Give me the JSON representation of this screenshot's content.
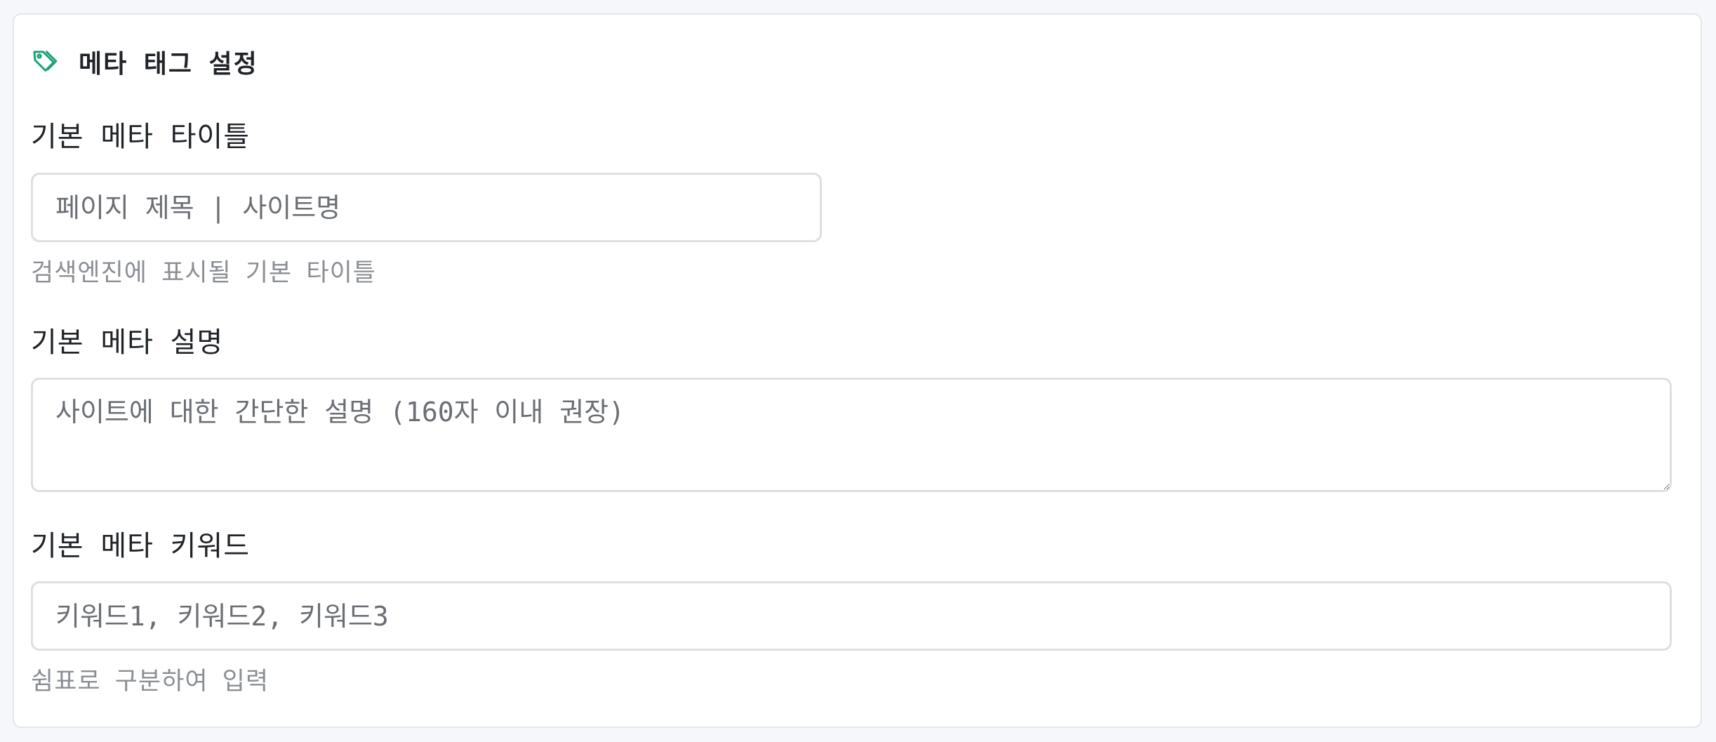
{
  "section": {
    "icon": "tag-icon",
    "title": "메타 태그 설정",
    "accent_color": "#1aa37a"
  },
  "fields": {
    "meta_title": {
      "label": "기본 메타 타이틀",
      "placeholder": "페이지 제목 | 사이트명",
      "value": "",
      "help": "검색엔진에 표시될 기본 타이틀"
    },
    "meta_description": {
      "label": "기본 메타 설명",
      "placeholder": "사이트에 대한 간단한 설명 (160자 이내 권장)",
      "value": ""
    },
    "meta_keywords": {
      "label": "기본 메타 키워드",
      "placeholder": "키워드1, 키워드2, 키워드3",
      "value": "",
      "help": "쉼표로 구분하여 입력"
    }
  }
}
